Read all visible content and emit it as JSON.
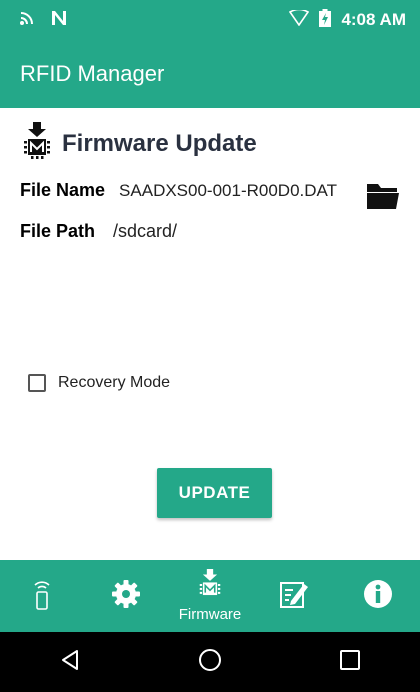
{
  "status_bar": {
    "time": "4:08 AM"
  },
  "app_bar": {
    "title": "RFID Manager"
  },
  "firmware": {
    "title": "Firmware Update",
    "file_name_label": "File Name",
    "file_name_value": "SAADXS00-001-R00D0.DAT",
    "file_path_label": "File Path",
    "file_path_value": "/sdcard/",
    "recovery_mode_label": "Recovery Mode",
    "recovery_mode_checked": false,
    "update_button": "UPDATE"
  },
  "bottom_nav": {
    "items": [
      {
        "icon": "rfid-reader-icon",
        "label": ""
      },
      {
        "icon": "gear-icon",
        "label": ""
      },
      {
        "icon": "firmware-chip-icon",
        "label": "Firmware",
        "active": true
      },
      {
        "icon": "edit-note-icon",
        "label": ""
      },
      {
        "icon": "info-icon",
        "label": ""
      }
    ]
  },
  "colors": {
    "primary": "#24a889",
    "title_text": "#2a3140"
  }
}
